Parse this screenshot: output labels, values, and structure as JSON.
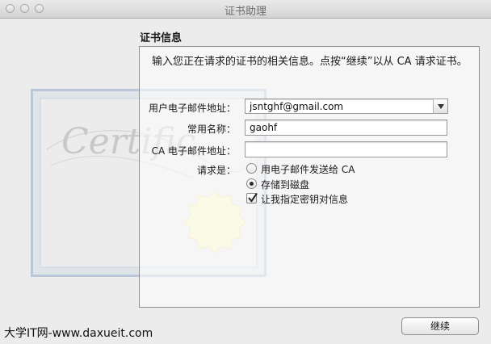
{
  "window": {
    "title": "证书助理"
  },
  "section": {
    "title": "证书信息",
    "intro": "输入您正在请求的证书的相关信息。点按“继续”以从 CA 请求证书。"
  },
  "form": {
    "user_email": {
      "label": "用户电子邮件地址：",
      "value": "jsntghf@gmail.com"
    },
    "common_name": {
      "label": "常用名称：",
      "value": "gaohf"
    },
    "ca_email": {
      "label": "CA 电子邮件地址：",
      "value": ""
    },
    "request_label": "请求是：",
    "options": [
      {
        "label": "用电子邮件发送给 CA",
        "selected": false
      },
      {
        "label": "存储到磁盘",
        "selected": true
      }
    ],
    "specify_key": {
      "label": "让我指定密钥对信息",
      "checked": true
    }
  },
  "artwork": {
    "script_text": "Certific"
  },
  "buttons": {
    "continue": "继续"
  },
  "watermark": "大学IT网-www.daxueit.com",
  "colors": {
    "panel_border": "#8f8f8f",
    "cert_frame": "#b9c7d9",
    "seal": "#f6f3c7"
  }
}
